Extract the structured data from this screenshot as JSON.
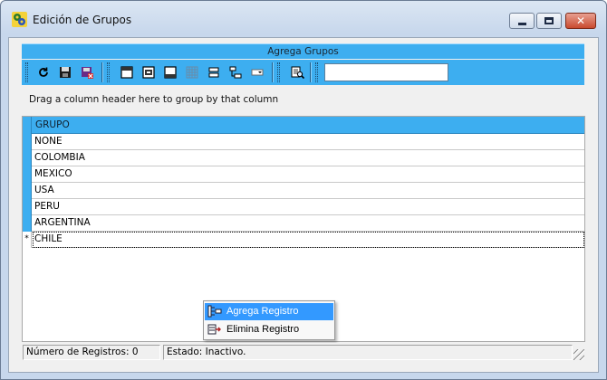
{
  "window": {
    "title": "Edición de Grupos",
    "icon": "app-gears-icon"
  },
  "header": {
    "title": "Agrega Grupos"
  },
  "toolbar": {
    "buttons": [
      {
        "name": "refresh-icon"
      },
      {
        "name": "save-icon"
      },
      {
        "name": "save-close-icon"
      },
      {
        "name": "layout-top-icon"
      },
      {
        "name": "print-preview-icon"
      },
      {
        "name": "layout-bottom-icon"
      },
      {
        "name": "grid-icon"
      },
      {
        "name": "split-rows-icon"
      },
      {
        "name": "tree-icon"
      },
      {
        "name": "combo-icon"
      },
      {
        "name": "find-icon"
      }
    ],
    "search_value": ""
  },
  "group_area": {
    "hint": "Drag a column header here to group by that column"
  },
  "grid": {
    "column": "GRUPO",
    "rows": [
      "NONE",
      "COLOMBIA",
      "MEXICO",
      "USA",
      "PERU",
      "ARGENTINA"
    ],
    "new_row": {
      "indicator": "*",
      "value": "CHILE"
    }
  },
  "context_menu": {
    "items": [
      {
        "label": "Agrega Registro",
        "icon": "add-record-icon",
        "highlighted": true
      },
      {
        "label": "Elimina Registro",
        "icon": "delete-record-icon",
        "highlighted": false
      }
    ]
  },
  "status": {
    "records": "Número de Registros: 0",
    "state": "Estado: Inactivo."
  },
  "colors": {
    "accent": "#3daef0",
    "highlight": "#3399ff"
  }
}
